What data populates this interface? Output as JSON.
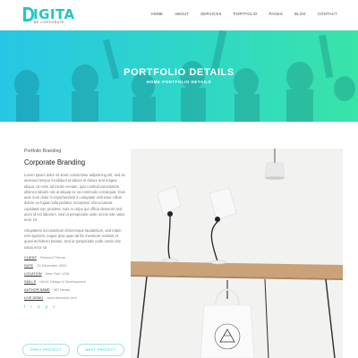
{
  "header": {
    "logo_text": "IGITA",
    "logo_tagline": "BE CORPORATE",
    "nav": [
      "HOME",
      "ABOUT",
      "SERVICES",
      "PORTFOLIO",
      "PAGES",
      "BLOG",
      "CONTACT"
    ]
  },
  "banner": {
    "title": "PORTFOLIO DETAILS",
    "breadcrumb": "HOME PORTFOLIO DETAILS"
  },
  "project": {
    "category": "Portfolio Branding",
    "title": "Corporate Branding",
    "paragraph_1": "Lorem ipsum dolor sit amet consectetur adipisicing elit, sed do eiusmod tempor incididunt ut labore et dolore and magna aliqua. Ut enim ad minim veniam, quis nostrud exercitation ullamco laboris nisi ut aliquip ex ea commodo consequat. Duis aute irure dolor in reprehenderit in voluptate velit esse cillum dolore eu fugiat nulla pariatur. Excepteur sint occaecat cupidatat non proident, sunt in culpa qui officia deserunt and anim id est laborum. Sed ut perspiciatis unde omnis iste natus error sit",
    "paragraph_2": "voluptatem accusantium doloremque laudantium, and totam rem aperiam, eaque ipsa quae ab illo inventore veritatis et quasi architecto beatae. Sed ut perspiciatis unde omnis iste natus error sit",
    "meta": [
      {
        "label": "CLIENT",
        "value": "Redcord Theme"
      },
      {
        "label": "DATE",
        "value": "20 December 2020"
      },
      {
        "label": "LOCATION",
        "value": "New York, USA"
      },
      {
        "label": "SKILLS",
        "value": "UI/UX Design & Development"
      },
      {
        "label": "AUTHOR NAME",
        "value": "MS Nerasi"
      },
      {
        "label": "LIVE DEMO",
        "value": "www.demolink.com"
      }
    ],
    "social_icons": [
      "facebook-icon",
      "twitter-icon",
      "instagram-icon",
      "pinterest-icon",
      "vimeo-icon"
    ]
  },
  "buttons": {
    "prev": "PREV PROJECT",
    "next": "NEXT PROJECT"
  },
  "colors": {
    "accent": "#20c9c3",
    "banner_start": "#25c7e4",
    "banner_end": "#38e4a8"
  }
}
